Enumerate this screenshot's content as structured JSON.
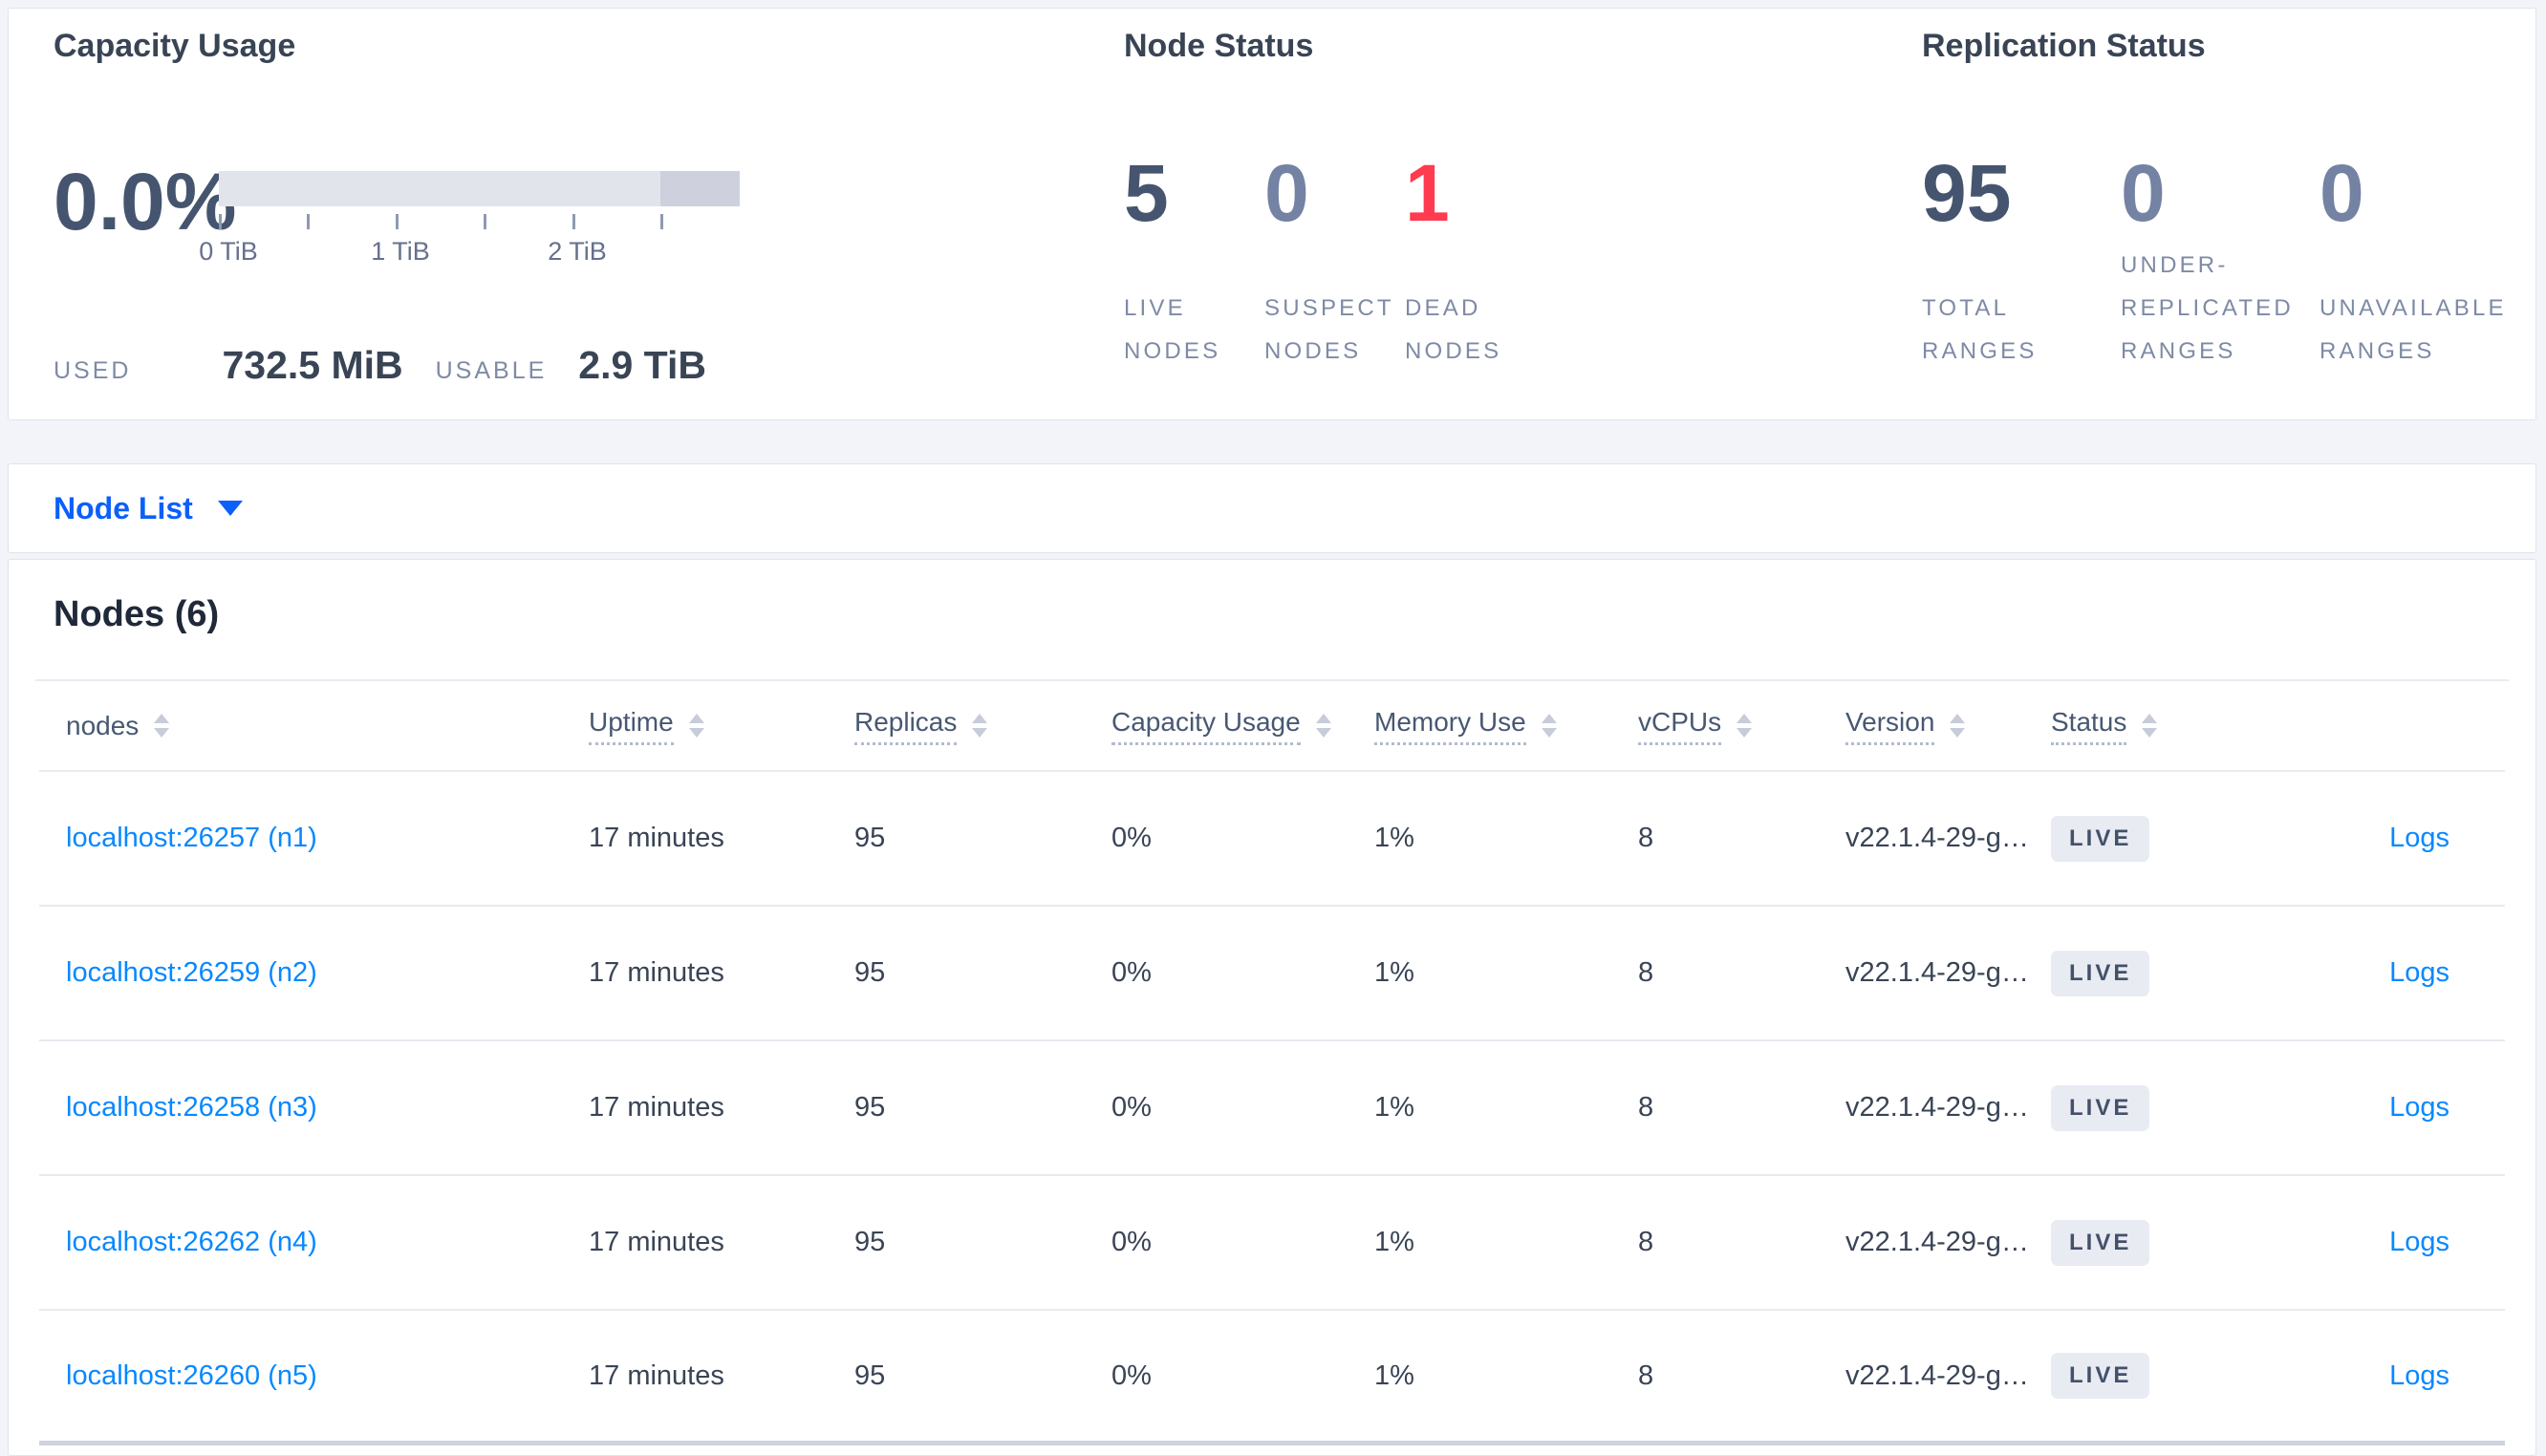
{
  "colors": {
    "accent_blue": "#0b5ffb",
    "link_blue": "#0788ff",
    "dead_red": "#ff3b4f",
    "dark_slate": "#46556f",
    "muted_slate": "#7482a3",
    "badge_bg": "#e8ebf2",
    "bar_light": "#e2e4ec",
    "bar_dark": "#ced1dd"
  },
  "summary": {
    "capacity": {
      "title": "Capacity Usage",
      "percent": "0.0%",
      "tick_labels": {
        "t0": "0 TiB",
        "t1": "1 TiB",
        "t2": "2 TiB"
      },
      "used_label": "USED",
      "used_value": "732.5 MiB",
      "usable_label": "USABLE",
      "usable_value": "2.9 TiB"
    },
    "node_status": {
      "title": "Node Status",
      "metrics": [
        {
          "value": "5",
          "label": "LIVE NODES"
        },
        {
          "value": "0",
          "label": "SUSPECT NODES"
        },
        {
          "value": "1",
          "label": "DEAD NODES"
        }
      ]
    },
    "replication_status": {
      "title": "Replication Status",
      "metrics": [
        {
          "value": "95",
          "label": "TOTAL RANGES"
        },
        {
          "value": "0",
          "label": "UNDER-REPLICATED RANGES"
        },
        {
          "value": "0",
          "label": "UNAVAILABLE RANGES"
        }
      ]
    }
  },
  "node_list": {
    "selector_label": "Node List"
  },
  "nodes_table": {
    "title": "Nodes (6)",
    "columns": [
      "nodes",
      "Uptime",
      "Replicas",
      "Capacity Usage",
      "Memory Use",
      "vCPUs",
      "Version",
      "Status"
    ],
    "rows": [
      {
        "node": "localhost:26257 (n1)",
        "uptime": "17 minutes",
        "replicas": "95",
        "capacity": "0%",
        "memory": "1%",
        "vcpus": "8",
        "version": "v22.1.4-29-g…",
        "status": "LIVE",
        "logs": "Logs"
      },
      {
        "node": "localhost:26259 (n2)",
        "uptime": "17 minutes",
        "replicas": "95",
        "capacity": "0%",
        "memory": "1%",
        "vcpus": "8",
        "version": "v22.1.4-29-g…",
        "status": "LIVE",
        "logs": "Logs"
      },
      {
        "node": "localhost:26258 (n3)",
        "uptime": "17 minutes",
        "replicas": "95",
        "capacity": "0%",
        "memory": "1%",
        "vcpus": "8",
        "version": "v22.1.4-29-g…",
        "status": "LIVE",
        "logs": "Logs"
      },
      {
        "node": "localhost:26262 (n4)",
        "uptime": "17 minutes",
        "replicas": "95",
        "capacity": "0%",
        "memory": "1%",
        "vcpus": "8",
        "version": "v22.1.4-29-g…",
        "status": "LIVE",
        "logs": "Logs"
      },
      {
        "node": "localhost:26260 (n5)",
        "uptime": "17 minutes",
        "replicas": "95",
        "capacity": "0%",
        "memory": "1%",
        "vcpus": "8",
        "version": "v22.1.4-29-g…",
        "status": "LIVE",
        "logs": "Logs"
      }
    ]
  }
}
